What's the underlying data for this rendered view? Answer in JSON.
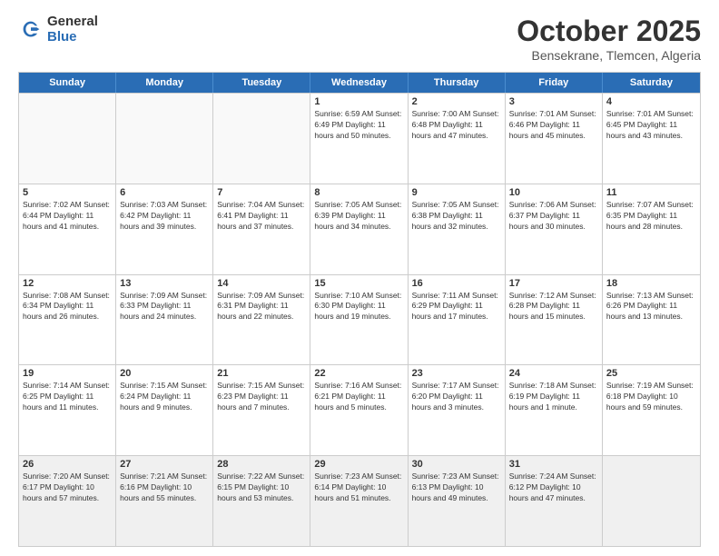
{
  "header": {
    "logo_general": "General",
    "logo_blue": "Blue",
    "title": "October 2025",
    "location": "Bensekrane, Tlemcen, Algeria"
  },
  "days_of_week": [
    "Sunday",
    "Monday",
    "Tuesday",
    "Wednesday",
    "Thursday",
    "Friday",
    "Saturday"
  ],
  "weeks": [
    [
      {
        "day": "",
        "info": ""
      },
      {
        "day": "",
        "info": ""
      },
      {
        "day": "",
        "info": ""
      },
      {
        "day": "1",
        "info": "Sunrise: 6:59 AM\nSunset: 6:49 PM\nDaylight: 11 hours and 50 minutes."
      },
      {
        "day": "2",
        "info": "Sunrise: 7:00 AM\nSunset: 6:48 PM\nDaylight: 11 hours and 47 minutes."
      },
      {
        "day": "3",
        "info": "Sunrise: 7:01 AM\nSunset: 6:46 PM\nDaylight: 11 hours and 45 minutes."
      },
      {
        "day": "4",
        "info": "Sunrise: 7:01 AM\nSunset: 6:45 PM\nDaylight: 11 hours and 43 minutes."
      }
    ],
    [
      {
        "day": "5",
        "info": "Sunrise: 7:02 AM\nSunset: 6:44 PM\nDaylight: 11 hours and 41 minutes."
      },
      {
        "day": "6",
        "info": "Sunrise: 7:03 AM\nSunset: 6:42 PM\nDaylight: 11 hours and 39 minutes."
      },
      {
        "day": "7",
        "info": "Sunrise: 7:04 AM\nSunset: 6:41 PM\nDaylight: 11 hours and 37 minutes."
      },
      {
        "day": "8",
        "info": "Sunrise: 7:05 AM\nSunset: 6:39 PM\nDaylight: 11 hours and 34 minutes."
      },
      {
        "day": "9",
        "info": "Sunrise: 7:05 AM\nSunset: 6:38 PM\nDaylight: 11 hours and 32 minutes."
      },
      {
        "day": "10",
        "info": "Sunrise: 7:06 AM\nSunset: 6:37 PM\nDaylight: 11 hours and 30 minutes."
      },
      {
        "day": "11",
        "info": "Sunrise: 7:07 AM\nSunset: 6:35 PM\nDaylight: 11 hours and 28 minutes."
      }
    ],
    [
      {
        "day": "12",
        "info": "Sunrise: 7:08 AM\nSunset: 6:34 PM\nDaylight: 11 hours and 26 minutes."
      },
      {
        "day": "13",
        "info": "Sunrise: 7:09 AM\nSunset: 6:33 PM\nDaylight: 11 hours and 24 minutes."
      },
      {
        "day": "14",
        "info": "Sunrise: 7:09 AM\nSunset: 6:31 PM\nDaylight: 11 hours and 22 minutes."
      },
      {
        "day": "15",
        "info": "Sunrise: 7:10 AM\nSunset: 6:30 PM\nDaylight: 11 hours and 19 minutes."
      },
      {
        "day": "16",
        "info": "Sunrise: 7:11 AM\nSunset: 6:29 PM\nDaylight: 11 hours and 17 minutes."
      },
      {
        "day": "17",
        "info": "Sunrise: 7:12 AM\nSunset: 6:28 PM\nDaylight: 11 hours and 15 minutes."
      },
      {
        "day": "18",
        "info": "Sunrise: 7:13 AM\nSunset: 6:26 PM\nDaylight: 11 hours and 13 minutes."
      }
    ],
    [
      {
        "day": "19",
        "info": "Sunrise: 7:14 AM\nSunset: 6:25 PM\nDaylight: 11 hours and 11 minutes."
      },
      {
        "day": "20",
        "info": "Sunrise: 7:15 AM\nSunset: 6:24 PM\nDaylight: 11 hours and 9 minutes."
      },
      {
        "day": "21",
        "info": "Sunrise: 7:15 AM\nSunset: 6:23 PM\nDaylight: 11 hours and 7 minutes."
      },
      {
        "day": "22",
        "info": "Sunrise: 7:16 AM\nSunset: 6:21 PM\nDaylight: 11 hours and 5 minutes."
      },
      {
        "day": "23",
        "info": "Sunrise: 7:17 AM\nSunset: 6:20 PM\nDaylight: 11 hours and 3 minutes."
      },
      {
        "day": "24",
        "info": "Sunrise: 7:18 AM\nSunset: 6:19 PM\nDaylight: 11 hours and 1 minute."
      },
      {
        "day": "25",
        "info": "Sunrise: 7:19 AM\nSunset: 6:18 PM\nDaylight: 10 hours and 59 minutes."
      }
    ],
    [
      {
        "day": "26",
        "info": "Sunrise: 7:20 AM\nSunset: 6:17 PM\nDaylight: 10 hours and 57 minutes."
      },
      {
        "day": "27",
        "info": "Sunrise: 7:21 AM\nSunset: 6:16 PM\nDaylight: 10 hours and 55 minutes."
      },
      {
        "day": "28",
        "info": "Sunrise: 7:22 AM\nSunset: 6:15 PM\nDaylight: 10 hours and 53 minutes."
      },
      {
        "day": "29",
        "info": "Sunrise: 7:23 AM\nSunset: 6:14 PM\nDaylight: 10 hours and 51 minutes."
      },
      {
        "day": "30",
        "info": "Sunrise: 7:23 AM\nSunset: 6:13 PM\nDaylight: 10 hours and 49 minutes."
      },
      {
        "day": "31",
        "info": "Sunrise: 7:24 AM\nSunset: 6:12 PM\nDaylight: 10 hours and 47 minutes."
      },
      {
        "day": "",
        "info": ""
      }
    ]
  ]
}
